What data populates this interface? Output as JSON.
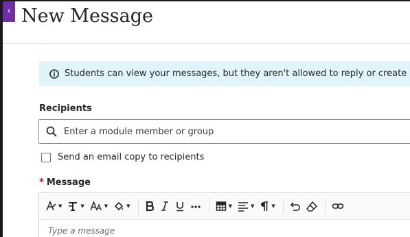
{
  "dialog": {
    "close_glyph": "‹",
    "title": "New Message"
  },
  "info_banner": {
    "icon": "info-icon",
    "text": "Students can view your messages, but they aren't allowed to reply or create messages."
  },
  "recipients": {
    "label": "Recipients",
    "icon": "search-icon",
    "placeholder": "Enter a module member or group"
  },
  "email_copy": {
    "label": "Send an email copy to recipients",
    "checked": false
  },
  "message": {
    "required_mark": "*",
    "label": "Message",
    "placeholder": "Type a message"
  },
  "toolbar": {
    "tools": [
      "text-style-icon",
      "font-format-icon",
      "font-size-icon",
      "fill-color-icon",
      "bold-icon",
      "italic-icon",
      "underline-icon",
      "more-icon",
      "table-icon",
      "align-icon",
      "paragraph-icon",
      "undo-icon",
      "eraser-icon",
      "link-icon"
    ]
  },
  "colors": {
    "accent": "#6f2da8",
    "info_bg": "#dff5fb",
    "required": "#c8102e"
  }
}
